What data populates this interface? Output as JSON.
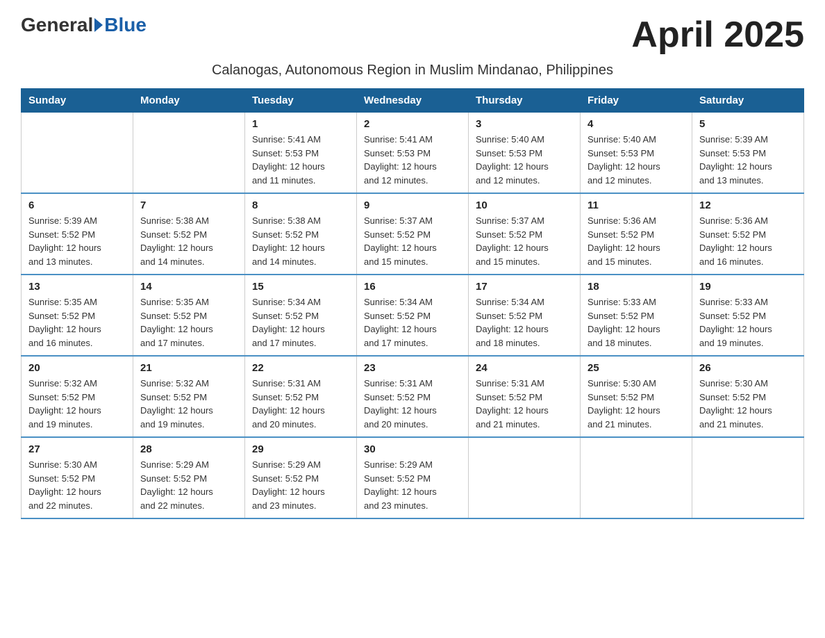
{
  "header": {
    "logo_general": "General",
    "logo_blue": "Blue",
    "month_title": "April 2025",
    "subtitle": "Calanogas, Autonomous Region in Muslim Mindanao, Philippines"
  },
  "days_of_week": [
    "Sunday",
    "Monday",
    "Tuesday",
    "Wednesday",
    "Thursday",
    "Friday",
    "Saturday"
  ],
  "weeks": [
    [
      {
        "day": "",
        "info": ""
      },
      {
        "day": "",
        "info": ""
      },
      {
        "day": "1",
        "info": "Sunrise: 5:41 AM\nSunset: 5:53 PM\nDaylight: 12 hours\nand 11 minutes."
      },
      {
        "day": "2",
        "info": "Sunrise: 5:41 AM\nSunset: 5:53 PM\nDaylight: 12 hours\nand 12 minutes."
      },
      {
        "day": "3",
        "info": "Sunrise: 5:40 AM\nSunset: 5:53 PM\nDaylight: 12 hours\nand 12 minutes."
      },
      {
        "day": "4",
        "info": "Sunrise: 5:40 AM\nSunset: 5:53 PM\nDaylight: 12 hours\nand 12 minutes."
      },
      {
        "day": "5",
        "info": "Sunrise: 5:39 AM\nSunset: 5:53 PM\nDaylight: 12 hours\nand 13 minutes."
      }
    ],
    [
      {
        "day": "6",
        "info": "Sunrise: 5:39 AM\nSunset: 5:52 PM\nDaylight: 12 hours\nand 13 minutes."
      },
      {
        "day": "7",
        "info": "Sunrise: 5:38 AM\nSunset: 5:52 PM\nDaylight: 12 hours\nand 14 minutes."
      },
      {
        "day": "8",
        "info": "Sunrise: 5:38 AM\nSunset: 5:52 PM\nDaylight: 12 hours\nand 14 minutes."
      },
      {
        "day": "9",
        "info": "Sunrise: 5:37 AM\nSunset: 5:52 PM\nDaylight: 12 hours\nand 15 minutes."
      },
      {
        "day": "10",
        "info": "Sunrise: 5:37 AM\nSunset: 5:52 PM\nDaylight: 12 hours\nand 15 minutes."
      },
      {
        "day": "11",
        "info": "Sunrise: 5:36 AM\nSunset: 5:52 PM\nDaylight: 12 hours\nand 15 minutes."
      },
      {
        "day": "12",
        "info": "Sunrise: 5:36 AM\nSunset: 5:52 PM\nDaylight: 12 hours\nand 16 minutes."
      }
    ],
    [
      {
        "day": "13",
        "info": "Sunrise: 5:35 AM\nSunset: 5:52 PM\nDaylight: 12 hours\nand 16 minutes."
      },
      {
        "day": "14",
        "info": "Sunrise: 5:35 AM\nSunset: 5:52 PM\nDaylight: 12 hours\nand 17 minutes."
      },
      {
        "day": "15",
        "info": "Sunrise: 5:34 AM\nSunset: 5:52 PM\nDaylight: 12 hours\nand 17 minutes."
      },
      {
        "day": "16",
        "info": "Sunrise: 5:34 AM\nSunset: 5:52 PM\nDaylight: 12 hours\nand 17 minutes."
      },
      {
        "day": "17",
        "info": "Sunrise: 5:34 AM\nSunset: 5:52 PM\nDaylight: 12 hours\nand 18 minutes."
      },
      {
        "day": "18",
        "info": "Sunrise: 5:33 AM\nSunset: 5:52 PM\nDaylight: 12 hours\nand 18 minutes."
      },
      {
        "day": "19",
        "info": "Sunrise: 5:33 AM\nSunset: 5:52 PM\nDaylight: 12 hours\nand 19 minutes."
      }
    ],
    [
      {
        "day": "20",
        "info": "Sunrise: 5:32 AM\nSunset: 5:52 PM\nDaylight: 12 hours\nand 19 minutes."
      },
      {
        "day": "21",
        "info": "Sunrise: 5:32 AM\nSunset: 5:52 PM\nDaylight: 12 hours\nand 19 minutes."
      },
      {
        "day": "22",
        "info": "Sunrise: 5:31 AM\nSunset: 5:52 PM\nDaylight: 12 hours\nand 20 minutes."
      },
      {
        "day": "23",
        "info": "Sunrise: 5:31 AM\nSunset: 5:52 PM\nDaylight: 12 hours\nand 20 minutes."
      },
      {
        "day": "24",
        "info": "Sunrise: 5:31 AM\nSunset: 5:52 PM\nDaylight: 12 hours\nand 21 minutes."
      },
      {
        "day": "25",
        "info": "Sunrise: 5:30 AM\nSunset: 5:52 PM\nDaylight: 12 hours\nand 21 minutes."
      },
      {
        "day": "26",
        "info": "Sunrise: 5:30 AM\nSunset: 5:52 PM\nDaylight: 12 hours\nand 21 minutes."
      }
    ],
    [
      {
        "day": "27",
        "info": "Sunrise: 5:30 AM\nSunset: 5:52 PM\nDaylight: 12 hours\nand 22 minutes."
      },
      {
        "day": "28",
        "info": "Sunrise: 5:29 AM\nSunset: 5:52 PM\nDaylight: 12 hours\nand 22 minutes."
      },
      {
        "day": "29",
        "info": "Sunrise: 5:29 AM\nSunset: 5:52 PM\nDaylight: 12 hours\nand 23 minutes."
      },
      {
        "day": "30",
        "info": "Sunrise: 5:29 AM\nSunset: 5:52 PM\nDaylight: 12 hours\nand 23 minutes."
      },
      {
        "day": "",
        "info": ""
      },
      {
        "day": "",
        "info": ""
      },
      {
        "day": "",
        "info": ""
      }
    ]
  ]
}
